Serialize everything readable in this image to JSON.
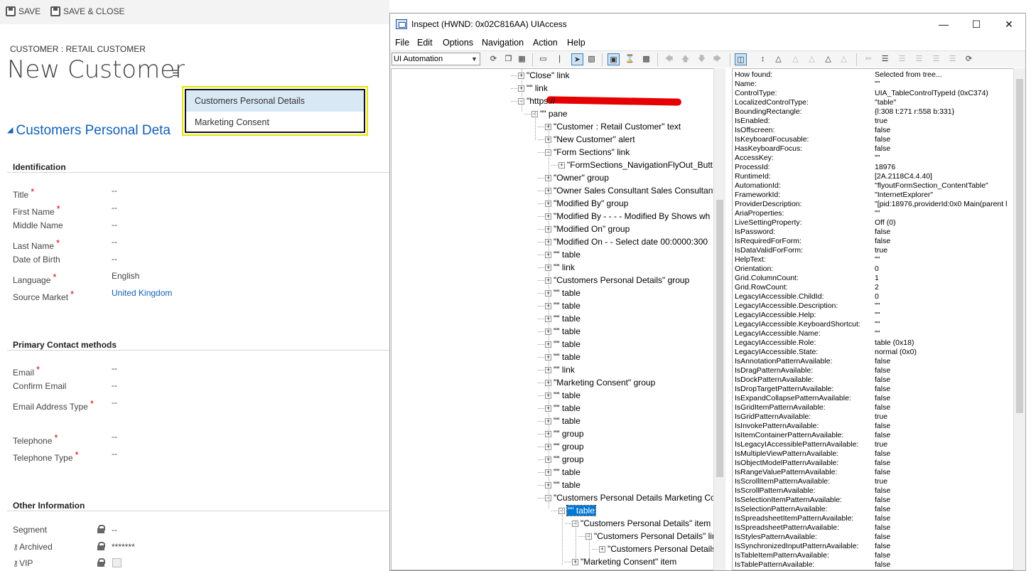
{
  "crm": {
    "save": "SAVE",
    "save_close": "SAVE & CLOSE",
    "entity_label": "CUSTOMER : RETAIL CUSTOMER",
    "title": "New Customer",
    "section_heading": "Customers Personal Deta",
    "flyout": [
      "Customers Personal Details",
      "Marketing Consent"
    ],
    "groups": {
      "identification": {
        "title": "Identification",
        "fields": [
          {
            "label": "Title",
            "required": true,
            "value": "--"
          },
          {
            "label": "First Name",
            "required": true,
            "value": "--"
          },
          {
            "label": "Middle Name",
            "required": false,
            "value": "--"
          },
          {
            "label": "Last Name",
            "required": true,
            "value": "--"
          },
          {
            "label": "Date of Birth",
            "required": false,
            "value": "--"
          },
          {
            "label": "Language",
            "required": true,
            "value": "English"
          },
          {
            "label": "Source Market",
            "required": true,
            "value": "United Kingdom"
          }
        ]
      },
      "contact": {
        "title": "Primary Contact methods",
        "fields": [
          {
            "label": "Email",
            "required": true,
            "value": "--"
          },
          {
            "label": "Confirm Email",
            "required": false,
            "value": "--"
          },
          {
            "label": "Email Address Type",
            "required": true,
            "value": "--"
          },
          {
            "label": "Telephone",
            "required": true,
            "value": "--"
          },
          {
            "label": "Telephone Type",
            "required": true,
            "value": "--"
          }
        ]
      },
      "other": {
        "title": "Other Information",
        "fields": [
          {
            "label": "Segment",
            "value": "--"
          },
          {
            "label": "Archived",
            "value": "*******"
          },
          {
            "label": "VIP",
            "value": ""
          }
        ]
      }
    },
    "required_mark": "*"
  },
  "inspect": {
    "title": "Inspect  (HWND: 0x02C816AA) UIAccess",
    "menu": [
      "File",
      "Edit",
      "Options",
      "Navigation",
      "Action",
      "Help"
    ],
    "mode": "UI Automation",
    "tree": [
      "\"Close\" link",
      "\"\" link",
      "\"https://",
      "\"\" pane",
      "\"Customer : Retail Customer\" text",
      "\"New Customer\" alert",
      "\"Form Sections\" link",
      "\"FormSections_NavigationFlyOut_Butt",
      "\"Owner\" group",
      "\"Owner Sales Consultant Sales Consultant",
      "\"Modified By\" group",
      "\"Modified By - - - -     Modified By Shows wh",
      "\"Modified On\" group",
      "\"Modified On - -     Select date   00:0000:300",
      "\"\" table",
      "\"\" link",
      "\"Customers Personal Details\" group",
      "\"\" table",
      "\"\" table",
      "\"\" table",
      "\"\" table",
      "\"\" table",
      "\"\" table",
      "\"\" link",
      "\"Marketing Consent\" group",
      "\"\" table",
      "\"\" table",
      "\"\" table",
      "\"\" group",
      "\"\" group",
      "\"\" group",
      "\"\" table",
      "\"\" table",
      "\"Customers Personal Details Marketing Co",
      "\"\" table",
      "\"Customers Personal Details\" item",
      "\"Customers Personal Details\" lin",
      "\"Customers Personal Details",
      "\"Marketing Consent\" item"
    ],
    "props": [
      [
        "How found:",
        "Selected from tree..."
      ],
      [
        "Name:",
        "\"\""
      ],
      [
        "ControlType:",
        "UIA_TableControlTypeId (0xC374)"
      ],
      [
        "LocalizedControlType:",
        "\"table\""
      ],
      [
        "BoundingRectangle:",
        "{l:308 t:271 r:558 b:331}"
      ],
      [
        "IsEnabled:",
        "true"
      ],
      [
        "IsOffscreen:",
        "false"
      ],
      [
        "IsKeyboardFocusable:",
        "false"
      ],
      [
        "HasKeyboardFocus:",
        "false"
      ],
      [
        "AccessKey:",
        "\"\""
      ],
      [
        "ProcessId:",
        "18976"
      ],
      [
        "RuntimeId:",
        "[2A.2118C4.4.40]"
      ],
      [
        "AutomationId:",
        "\"flyoutFormSection_ContentTable\""
      ],
      [
        "FrameworkId:",
        "\"InternetExplorer\""
      ],
      [
        "ProviderDescription:",
        "\"[pid:18976,providerId:0x0 Main(parent l"
      ],
      [
        "AriaProperties:",
        "\"\""
      ],
      [
        "LiveSettingProperty:",
        "Off (0)"
      ],
      [
        "IsPassword:",
        "false"
      ],
      [
        "IsRequiredForForm:",
        "false"
      ],
      [
        "IsDataValidForForm:",
        "true"
      ],
      [
        "HelpText:",
        "\"\""
      ],
      [
        "Orientation:",
        "0"
      ],
      [
        "Grid.ColumnCount:",
        "1"
      ],
      [
        "Grid.RowCount:",
        "2"
      ],
      [
        "LegacyIAccessible.ChildId:",
        "0"
      ],
      [
        "LegacyIAccessible.Description:",
        "\"\""
      ],
      [
        "LegacyIAccessible.Help:",
        "\"\""
      ],
      [
        "LegacyIAccessible.KeyboardShortcut:",
        "\"\""
      ],
      [
        "LegacyIAccessible.Name:",
        "\"\""
      ],
      [
        "LegacyIAccessible.Role:",
        "table (0x18)"
      ],
      [
        "LegacyIAccessible.State:",
        "normal (0x0)"
      ],
      [
        "IsAnnotationPatternAvailable:",
        "false"
      ],
      [
        "IsDragPatternAvailable:",
        "false"
      ],
      [
        "IsDockPatternAvailable:",
        "false"
      ],
      [
        "IsDropTargetPatternAvailable:",
        "false"
      ],
      [
        "IsExpandCollapsePatternAvailable:",
        "false"
      ],
      [
        "IsGridItemPatternAvailable:",
        "false"
      ],
      [
        "IsGridPatternAvailable:",
        "true"
      ],
      [
        "IsInvokePatternAvailable:",
        "false"
      ],
      [
        "IsItemContainerPatternAvailable:",
        "false"
      ],
      [
        "IsLegacyIAccessiblePatternAvailable:",
        "true"
      ],
      [
        "IsMultipleViewPatternAvailable:",
        "false"
      ],
      [
        "IsObjectModelPatternAvailable:",
        "false"
      ],
      [
        "IsRangeValuePatternAvailable:",
        "false"
      ],
      [
        "IsScrollItemPatternAvailable:",
        "true"
      ],
      [
        "IsScrollPatternAvailable:",
        "false"
      ],
      [
        "IsSelectionItemPatternAvailable:",
        "false"
      ],
      [
        "IsSelectionPatternAvailable:",
        "false"
      ],
      [
        "IsSpreadsheetItemPatternAvailable:",
        "false"
      ],
      [
        "IsSpreadsheetPatternAvailable:",
        "false"
      ],
      [
        "IsStylesPatternAvailable:",
        "false"
      ],
      [
        "IsSynchronizedInputPatternAvailable:",
        "false"
      ],
      [
        "IsTableItemPatternAvailable:",
        "false"
      ],
      [
        "IsTablePatternAvailable:",
        "false"
      ]
    ]
  },
  "colors": {
    "accent": "#1160b7",
    "required": "#dd0000",
    "selection": "#0078d7",
    "focus_frame": "#e5e500"
  },
  "icons": [
    "save-icon",
    "save-close-icon",
    "menu-lines-icon",
    "collapse-triangle-icon",
    "lock-icon",
    "key-icon",
    "minimize-icon",
    "maximize-icon",
    "close-icon",
    "dropdown-arrow-icon"
  ]
}
